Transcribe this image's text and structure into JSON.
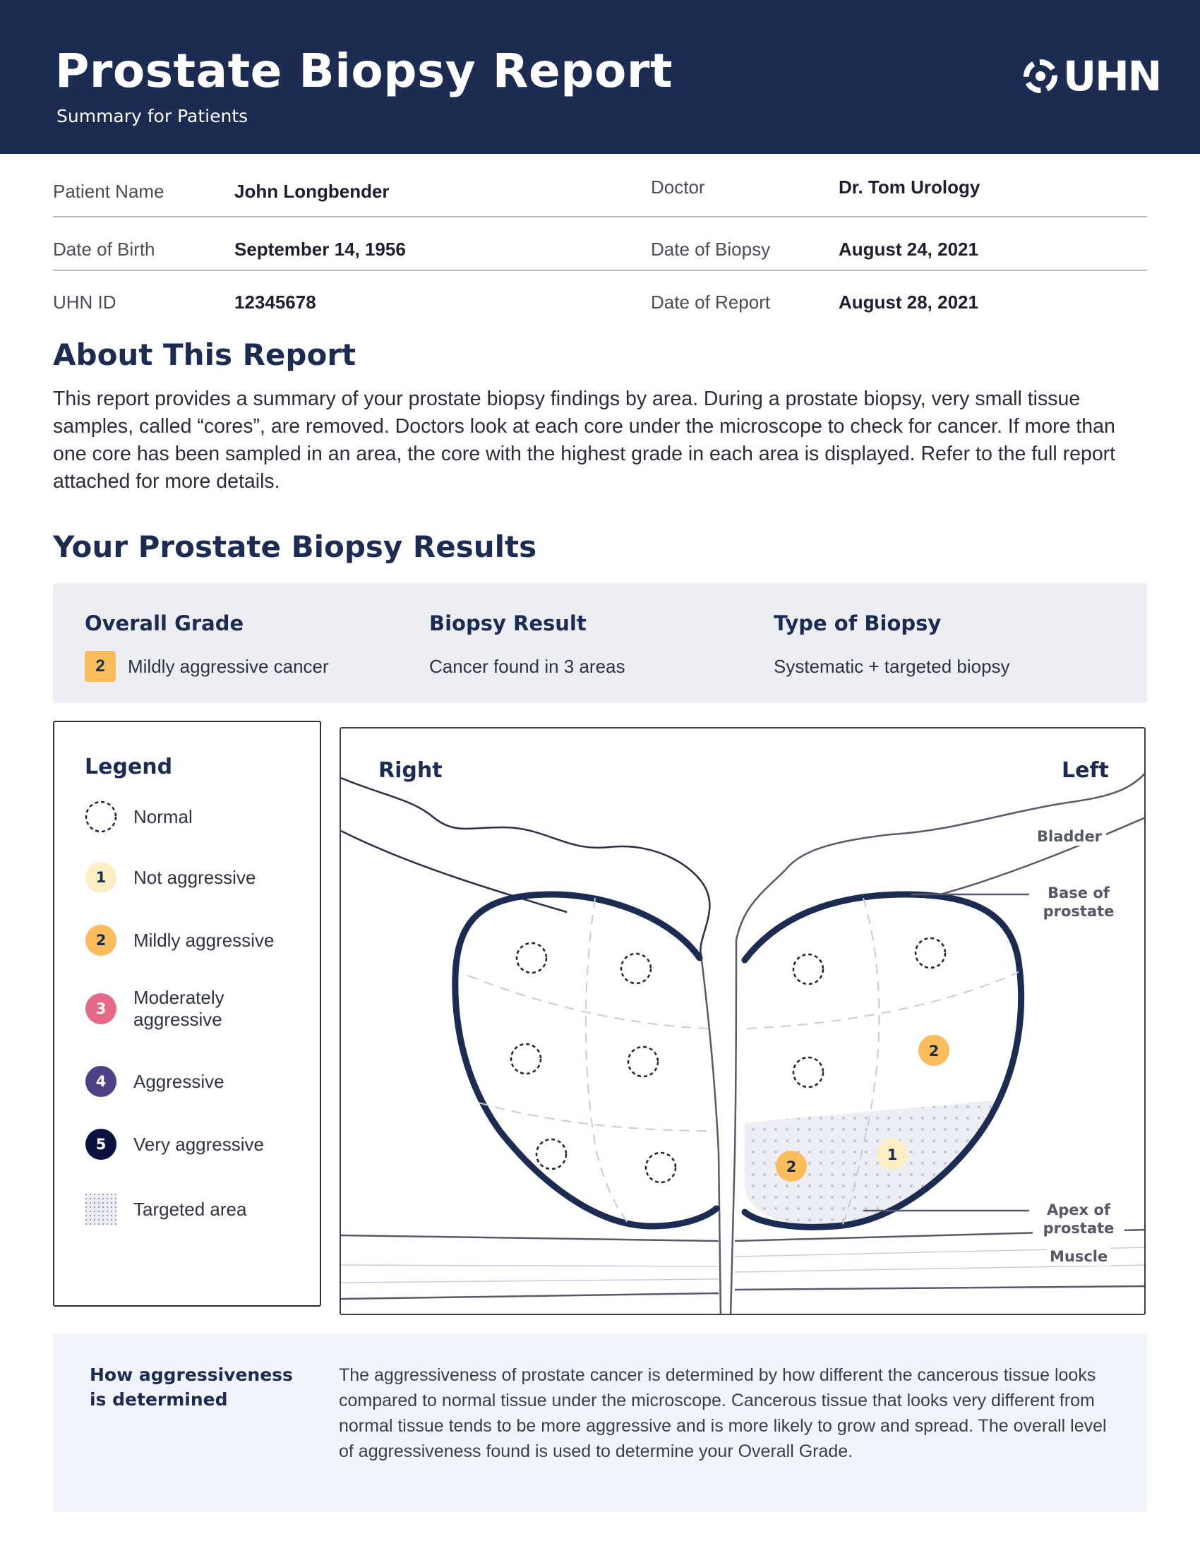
{
  "header": {
    "title": "Prostate Biopsy Report",
    "subtitle": "Summary for Patients",
    "logo_text": "UHN",
    "background": "#1c2b52"
  },
  "patient_info": {
    "patient_name_label": "Patient Name",
    "patient_name": "John Longbender",
    "doctor_label": "Doctor",
    "doctor": "Dr. Tom Urology",
    "dob_label": "Date of Birth",
    "dob": "September 14, 1956",
    "biopsy_date_label": "Date of Biopsy",
    "biopsy_date": "August 24, 2021",
    "uhn_id_label": "UHN ID",
    "uhn_id": "12345678",
    "report_date_label": "Date of Report",
    "report_date": "August 28, 2021"
  },
  "about": {
    "heading": "About This Report",
    "text": "This report provides a summary of your prostate biopsy findings by area. During a prostate biopsy, very small tissue samples, called “cores”, are removed. Doctors look at each core under the microscope to check for cancer.  If more than one core has been sampled in an area, the core with the highest grade in each area is displayed. Refer to the full report attached for more details."
  },
  "results": {
    "heading": "Your Prostate Biopsy Results",
    "overall_grade_title": "Overall Grade",
    "overall_grade_number": "2",
    "overall_grade_text": "Mildly aggressive cancer",
    "biopsy_result_title": "Biopsy Result",
    "biopsy_result_text": "Cancer found in 3 areas",
    "type_title": "Type of Biopsy",
    "type_text": "Systematic + targeted biopsy"
  },
  "legend": {
    "title": "Legend",
    "items": [
      {
        "label": "Normal",
        "mark": "dashed-circle"
      },
      {
        "label": "Not aggressive",
        "grade": "1",
        "color": "#fdefc4",
        "text_color": "#1c2b52"
      },
      {
        "label": "Mildly aggressive",
        "grade": "2",
        "color": "#fbbd5c",
        "text_color": "#1c2b52"
      },
      {
        "label": "Moderately aggressive",
        "grade": "3",
        "color": "#e56a87",
        "text_color": "#ffffff"
      },
      {
        "label": "Aggressive",
        "grade": "4",
        "color": "#4f3f86",
        "text_color": "#ffffff"
      },
      {
        "label": "Very aggressive",
        "grade": "5",
        "color": "#0b1240",
        "text_color": "#ffffff"
      },
      {
        "label": "Targeted area",
        "mark": "dotted-square"
      }
    ]
  },
  "diagram": {
    "right_label": "Right",
    "left_label": "Left",
    "bladder_label": "Bladder",
    "base_label": "Base of prostate",
    "apex_label": "Apex of prostate",
    "muscle_label": "Muscle",
    "right_lobe_cores": [
      "normal",
      "normal",
      "normal",
      "normal",
      "normal",
      "normal"
    ],
    "left_lobe_cores": [
      {
        "result": "normal"
      },
      {
        "result": "normal"
      },
      {
        "result": "normal"
      },
      {
        "result": "grade",
        "grade": "2"
      },
      {
        "result": "grade",
        "grade": "2",
        "targeted": true
      },
      {
        "result": "grade",
        "grade": "1",
        "targeted": true
      }
    ]
  },
  "aggressiveness_info": {
    "heading": "How aggressiveness is determined",
    "text": "The aggressiveness of prostate cancer is determined by how different the cancerous tissue looks compared to normal tissue under the microscope. Cancerous tissue that looks very different from normal tissue tends to be more aggressive and is more likely to grow and spread. The overall level of aggressiveness found is used to determine your Overall Grade."
  }
}
